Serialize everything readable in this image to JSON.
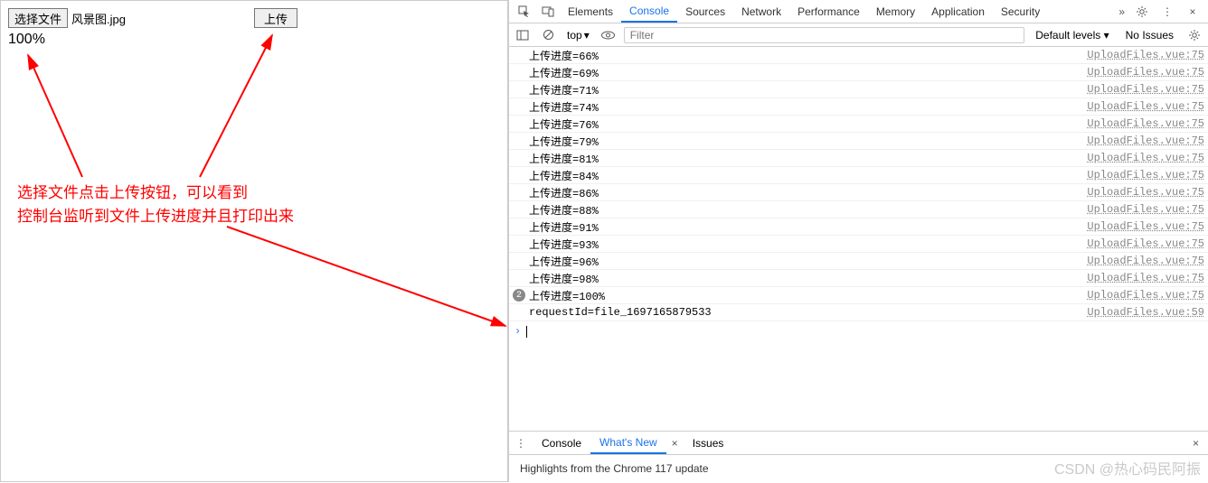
{
  "left": {
    "choose_label": "选择文件",
    "filename": "风景图.jpg",
    "upload_label": "上传",
    "progress": "100%",
    "annotation_line1": "选择文件点击上传按钮，可以看到",
    "annotation_line2": "控制台监听到文件上传进度并且打印出来"
  },
  "devtools": {
    "tabs": [
      "Elements",
      "Console",
      "Sources",
      "Network",
      "Performance",
      "Memory",
      "Application",
      "Security"
    ],
    "active_tab": "Console",
    "chevrons": "»",
    "toolbar": {
      "context": "top",
      "dropdown": "▾",
      "filter_placeholder": "Filter",
      "levels": "Default levels ▾",
      "issues": "No Issues"
    }
  },
  "console_logs": [
    {
      "msg": "上传进度=66%",
      "src": "UploadFiles.vue:75"
    },
    {
      "msg": "上传进度=69%",
      "src": "UploadFiles.vue:75"
    },
    {
      "msg": "上传进度=71%",
      "src": "UploadFiles.vue:75"
    },
    {
      "msg": "上传进度=74%",
      "src": "UploadFiles.vue:75"
    },
    {
      "msg": "上传进度=76%",
      "src": "UploadFiles.vue:75"
    },
    {
      "msg": "上传进度=79%",
      "src": "UploadFiles.vue:75"
    },
    {
      "msg": "上传进度=81%",
      "src": "UploadFiles.vue:75"
    },
    {
      "msg": "上传进度=84%",
      "src": "UploadFiles.vue:75"
    },
    {
      "msg": "上传进度=86%",
      "src": "UploadFiles.vue:75"
    },
    {
      "msg": "上传进度=88%",
      "src": "UploadFiles.vue:75"
    },
    {
      "msg": "上传进度=91%",
      "src": "UploadFiles.vue:75"
    },
    {
      "msg": "上传进度=93%",
      "src": "UploadFiles.vue:75"
    },
    {
      "msg": "上传进度=96%",
      "src": "UploadFiles.vue:75"
    },
    {
      "msg": "上传进度=98%",
      "src": "UploadFiles.vue:75"
    },
    {
      "msg": "上传进度=100%",
      "src": "UploadFiles.vue:75",
      "badge": "2"
    },
    {
      "msg": "requestId=file_1697165879533",
      "src": "UploadFiles.vue:59"
    }
  ],
  "prompt": "›",
  "drawer": {
    "menu": "⋮",
    "tabs": [
      "Console",
      "What's New",
      "Issues"
    ],
    "active": "What's New",
    "close": "×",
    "body": "Highlights from the Chrome 117 update"
  },
  "watermark": "CSDN @热心码民阿振"
}
